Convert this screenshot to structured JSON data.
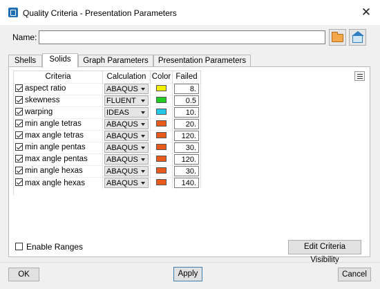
{
  "window": {
    "title": "Quality Criteria - Presentation Parameters",
    "close_glyph": "✕"
  },
  "name_field": {
    "label": "Name:",
    "value": ""
  },
  "toolbar": {
    "open_icon": "folder-icon",
    "save_icon": "save-icon"
  },
  "tabs": [
    {
      "label": "Shells",
      "active": false
    },
    {
      "label": "Solids",
      "active": true
    },
    {
      "label": "Graph Parameters",
      "active": false
    },
    {
      "label": "Presentation Parameters",
      "active": false
    }
  ],
  "table": {
    "headers": {
      "criteria": "Criteria",
      "calculation": "Calculation",
      "color": "Color",
      "failed": "Failed"
    },
    "rows": [
      {
        "checked": true,
        "criteria": "aspect ratio",
        "calculation": "ABAQUS",
        "color": "#f0f000",
        "failed": "8."
      },
      {
        "checked": true,
        "criteria": "skewness",
        "calculation": "FLUENT",
        "color": "#22cc22",
        "failed": "0.5"
      },
      {
        "checked": true,
        "criteria": "warping",
        "calculation": "IDEAS",
        "color": "#22c8e6",
        "failed": "10."
      },
      {
        "checked": true,
        "criteria": "min angle tetras",
        "calculation": "ABAQUS",
        "color": "#e85a1c",
        "failed": "20."
      },
      {
        "checked": true,
        "criteria": "max angle tetras",
        "calculation": "ABAQUS",
        "color": "#e85a1c",
        "failed": "120."
      },
      {
        "checked": true,
        "criteria": "min angle pentas",
        "calculation": "ABAQUS",
        "color": "#e85a1c",
        "failed": "30."
      },
      {
        "checked": true,
        "criteria": "max angle pentas",
        "calculation": "ABAQUS",
        "color": "#e85a1c",
        "failed": "120."
      },
      {
        "checked": true,
        "criteria": "min angle hexas",
        "calculation": "ABAQUS",
        "color": "#e85a1c",
        "failed": "30."
      },
      {
        "checked": true,
        "criteria": "max angle hexas",
        "calculation": "ABAQUS",
        "color": "#e85a1c",
        "failed": "140."
      }
    ]
  },
  "options": {
    "enable_ranges_label": "Enable Ranges",
    "enable_ranges_checked": false
  },
  "buttons": {
    "edit_visibility": "Edit Criteria Visibility",
    "ok": "OK",
    "apply": "Apply",
    "cancel": "Cancel"
  }
}
